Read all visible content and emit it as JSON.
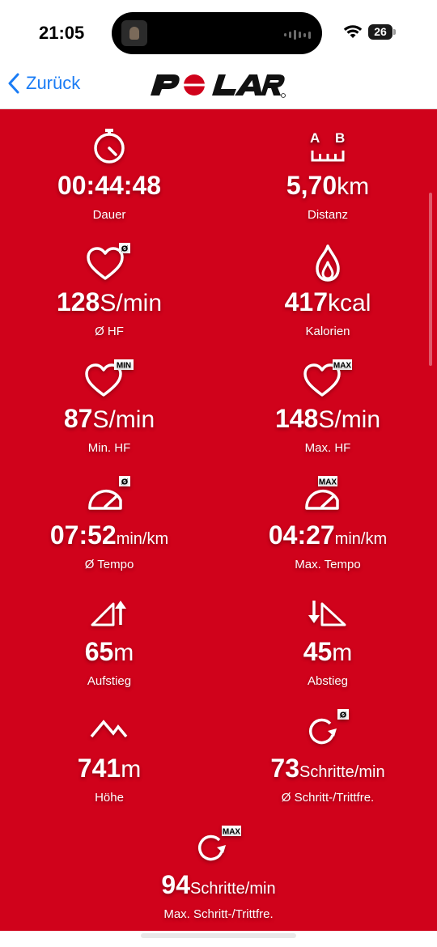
{
  "status_bar": {
    "time": "21:05",
    "battery": "26",
    "icons": [
      "wifi-icon",
      "battery-icon",
      "audio-wave-icon"
    ]
  },
  "nav": {
    "back_label": "Zurück",
    "logo_text": "POLAR",
    "back_color": "#1a7cf5",
    "brand_color": "#d0021b"
  },
  "metrics": [
    {
      "icon": "stopwatch-icon",
      "value": "00:44:48",
      "unit": "",
      "label": "Dauer"
    },
    {
      "icon": "distance-ab-icon",
      "value": "5,70",
      "unit": "km",
      "label": "Distanz"
    },
    {
      "icon": "heart-avg-icon",
      "value": "128",
      "unit": "S/min",
      "label": "Ø HF"
    },
    {
      "icon": "flame-icon",
      "value": "417",
      "unit": "kcal",
      "label": "Kalorien"
    },
    {
      "icon": "heart-min-icon",
      "value": "87",
      "unit": "S/min",
      "label": "Min. HF"
    },
    {
      "icon": "heart-max-icon",
      "value": "148",
      "unit": "S/min",
      "label": "Max. HF"
    },
    {
      "icon": "speedometer-avg-icon",
      "value": "07:52",
      "unit": "min/km",
      "label": "Ø Tempo"
    },
    {
      "icon": "speedometer-max-icon",
      "value": "04:27",
      "unit": "min/km",
      "label": "Max. Tempo"
    },
    {
      "icon": "ascent-icon",
      "value": "65",
      "unit": "m",
      "label": "Aufstieg"
    },
    {
      "icon": "descent-icon",
      "value": "45",
      "unit": "m",
      "label": "Abstieg"
    },
    {
      "icon": "mountain-icon",
      "value": "741",
      "unit": "m",
      "label": "Höhe"
    },
    {
      "icon": "cadence-avg-icon",
      "value": "73",
      "unit": "Schritte/min",
      "label": "Ø Schritt-/Trittfre."
    },
    {
      "icon": "cadence-max-icon",
      "value": "94",
      "unit": "Schritte/min",
      "label": "Max. Schritt-/Trittfre."
    }
  ],
  "badges": {
    "avg": "Ø",
    "min": "MIN",
    "max": "MAX",
    "a": "A",
    "b": "B"
  }
}
